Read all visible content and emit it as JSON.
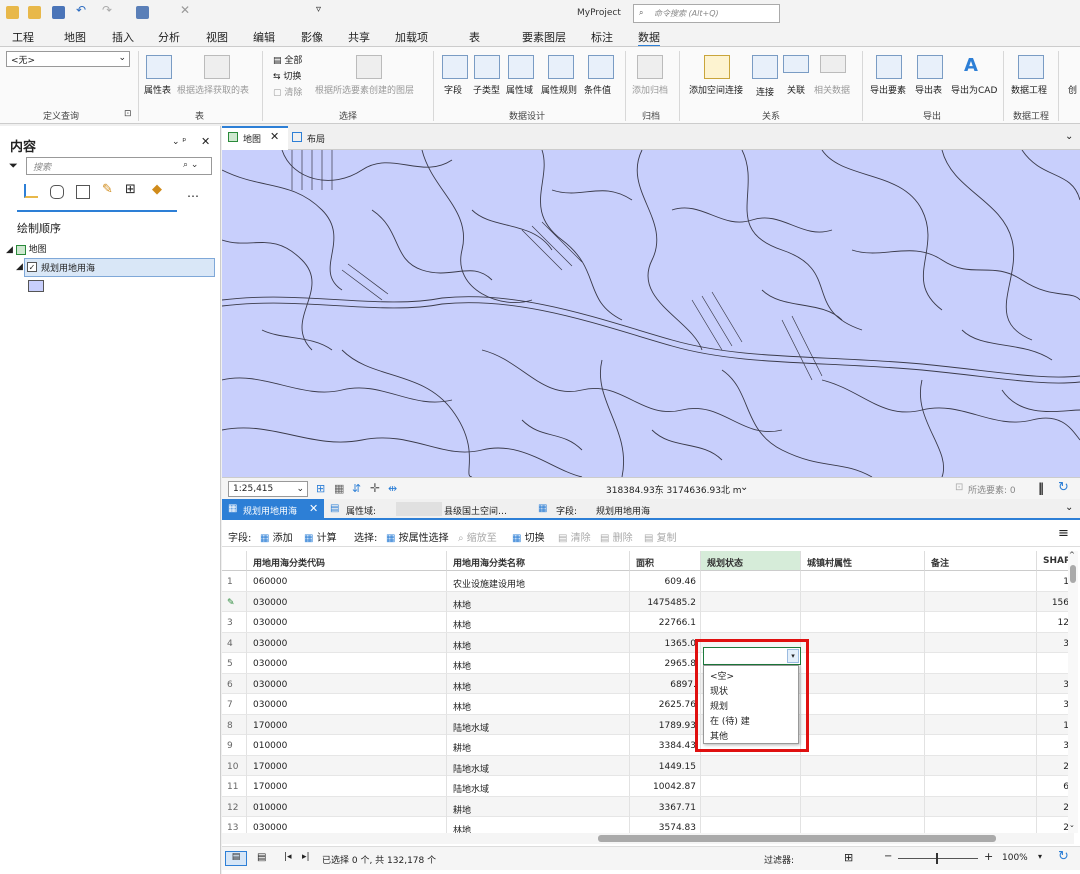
{
  "titlebar": {
    "project": "MyProject",
    "command_search_placeholder": "命令搜索 (Alt+Q)"
  },
  "ribbon_tabs": [
    "工程",
    "地图",
    "插入",
    "分析",
    "视图",
    "编辑",
    "影像",
    "共享",
    "加载项",
    "表",
    "要素图层",
    "标注",
    "数据"
  ],
  "ribbon": {
    "definition_query_value": "<无>",
    "groups": [
      "定义查询",
      "表",
      "选择",
      "数据设计",
      "归档",
      "关系",
      "导出",
      "数据工程"
    ],
    "buttons": {
      "attribute_table": "属性表",
      "get_from_selection": "根据选择获取的表",
      "all": "全部",
      "switch": "切换",
      "clear": "清除",
      "create_layer_from_selection": "根据所选要素创建的图层",
      "field": "字段",
      "subtype": "子类型",
      "attr_domain": "属性域",
      "attr_rules": "属性规则",
      "conditional_value": "条件值",
      "enable_archive": "添加归档",
      "add_spatial_join": "添加空间连接",
      "join": "连接",
      "relate": "关联",
      "related_data": "相关数据",
      "export_features": "导出要素",
      "export_table": "导出表",
      "export_cad": "导出为CAD",
      "data_engineering": "数据工程",
      "create": "创"
    }
  },
  "contents": {
    "title": "内容",
    "search_placeholder": "搜索",
    "draw_order": "绘制顺序",
    "map_item": "地图",
    "layer_item": "规划用地用海"
  },
  "map": {
    "tabs": [
      "地图",
      "布局"
    ],
    "scale": "1:25,415",
    "coordinates": "318384.93东 3174636.93北 m",
    "selected_features": "所选要素: 0"
  },
  "table": {
    "tabs": [
      "规划用地用海",
      "属性域:",
      "县级国土空间…",
      "字段:",
      "规划用地用海"
    ],
    "toolbar": {
      "field_label": "字段:",
      "add": "添加",
      "calculate": "计算",
      "select_label": "选择:",
      "select_by_attribute": "按属性选择",
      "zoom_to": "缩放至",
      "switch": "切换",
      "clear": "清除",
      "delete": "删除",
      "copy": "复制"
    },
    "columns": [
      "用地用海分类代码",
      "用地用海分类名称",
      "面积",
      "规划状态",
      "城镇村属性",
      "备注",
      "SHAP"
    ],
    "rows": [
      {
        "n": "1",
        "code": "060000",
        "name": "农业设施建设用地",
        "area": "609.46",
        "shape": "1"
      },
      {
        "n": "",
        "code": "030000",
        "name": "林地",
        "area": "1475485.2",
        "shape": "156"
      },
      {
        "n": "3",
        "code": "030000",
        "name": "林地",
        "area": "22766.1",
        "shape": "12"
      },
      {
        "n": "4",
        "code": "030000",
        "name": "林地",
        "area": "1365.0",
        "shape": "3"
      },
      {
        "n": "5",
        "code": "030000",
        "name": "林地",
        "area": "2965.8",
        "shape": ""
      },
      {
        "n": "6",
        "code": "030000",
        "name": "林地",
        "area": "6897.",
        "shape": "3"
      },
      {
        "n": "7",
        "code": "030000",
        "name": "林地",
        "area": "2625.76",
        "shape": "3"
      },
      {
        "n": "8",
        "code": "170000",
        "name": "陆地水域",
        "area": "1789.93",
        "shape": "1"
      },
      {
        "n": "9",
        "code": "010000",
        "name": "耕地",
        "area": "3384.43",
        "shape": "3"
      },
      {
        "n": "10",
        "code": "170000",
        "name": "陆地水域",
        "area": "1449.15",
        "shape": "2"
      },
      {
        "n": "11",
        "code": "170000",
        "name": "陆地水域",
        "area": "10042.87",
        "shape": "6"
      },
      {
        "n": "12",
        "code": "010000",
        "name": "耕地",
        "area": "3367.71",
        "shape": "2"
      },
      {
        "n": "13",
        "code": "030000",
        "name": "林地",
        "area": "3574.83",
        "shape": "2"
      }
    ],
    "dropdown_options": [
      "<空>",
      "现状",
      "规划",
      "在 (待) 建",
      "其他"
    ],
    "status": "已选择 0 个, 共 132,178 个",
    "filter_label": "过滤器:",
    "zoom": "100%"
  },
  "colors": {
    "map_fill": "#c8cffc",
    "map_lines": "#3a3a4a",
    "highlight_box": "#e01010",
    "accent": "#2d7fd6"
  }
}
